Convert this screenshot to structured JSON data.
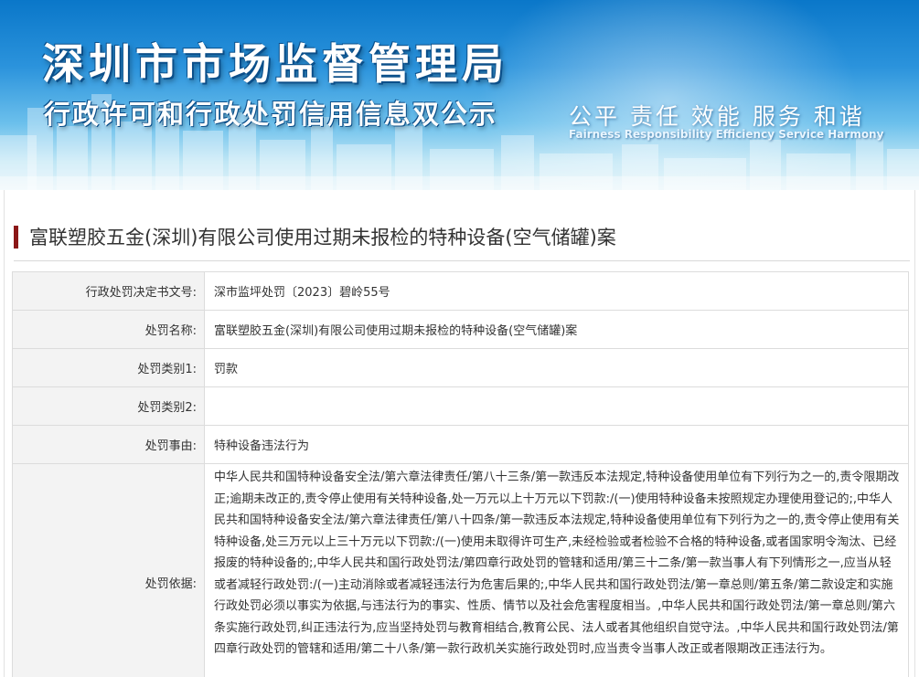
{
  "header": {
    "title": "深圳市市场监督管理局",
    "subtitle": "行政许可和行政处罚信用信息双公示",
    "slogan_cn": "公平  责任  效能  服务  和谐",
    "slogan_en": "Fairness  Responsibility  Efficiency  Service  Harmony"
  },
  "case": {
    "title": "富联塑胶五金(深圳)有限公司使用过期未报检的特种设备(空气储罐)案"
  },
  "rows": [
    {
      "label": "行政处罚决定书文号:",
      "value": "深市监坪处罚〔2023〕碧岭55号"
    },
    {
      "label": "处罚名称:",
      "value": "富联塑胶五金(深圳)有限公司使用过期未报检的特种设备(空气储罐)案"
    },
    {
      "label": "处罚类别1:",
      "value": "罚款"
    },
    {
      "label": "处罚类别2:",
      "value": ""
    },
    {
      "label": "处罚事由:",
      "value": "特种设备违法行为"
    },
    {
      "label": "处罚依据:",
      "value": "中华人民共和国特种设备安全法/第六章法律责任/第八十三条/第一款违反本法规定,特种设备使用单位有下列行为之一的,责令限期改正;逾期未改正的,责令停止使用有关特种设备,处一万元以上十万元以下罚款:/(一)使用特种设备未按照规定办理使用登记的;,中华人民共和国特种设备安全法/第六章法律责任/第八十四条/第一款违反本法规定,特种设备使用单位有下列行为之一的,责令停止使用有关特种设备,处三万元以上三十万元以下罚款:/(一)使用未取得许可生产,未经检验或者检验不合格的特种设备,或者国家明令淘汰、已经报废的特种设备的;,中华人民共和国行政处罚法/第四章行政处罚的管辖和适用/第三十二条/第一款当事人有下列情形之一,应当从轻或者减轻行政处罚:/(一)主动消除或者减轻违法行为危害后果的;,中华人民共和国行政处罚法/第一章总则/第五条/第二款设定和实施行政处罚必须以事实为依据,与违法行为的事实、性质、情节以及社会危害程度相当。,中华人民共和国行政处罚法/第一章总则/第六条实施行政处罚,纠正违法行为,应当坚持处罚与教育相结合,教育公民、法人或者其他组织自觉守法。,中华人民共和国行政处罚法/第四章行政处罚的管辖和适用/第二十八条/第一款行政机关实施行政处罚时,应当责令当事人改正或者限期改正违法行为。"
    }
  ]
}
